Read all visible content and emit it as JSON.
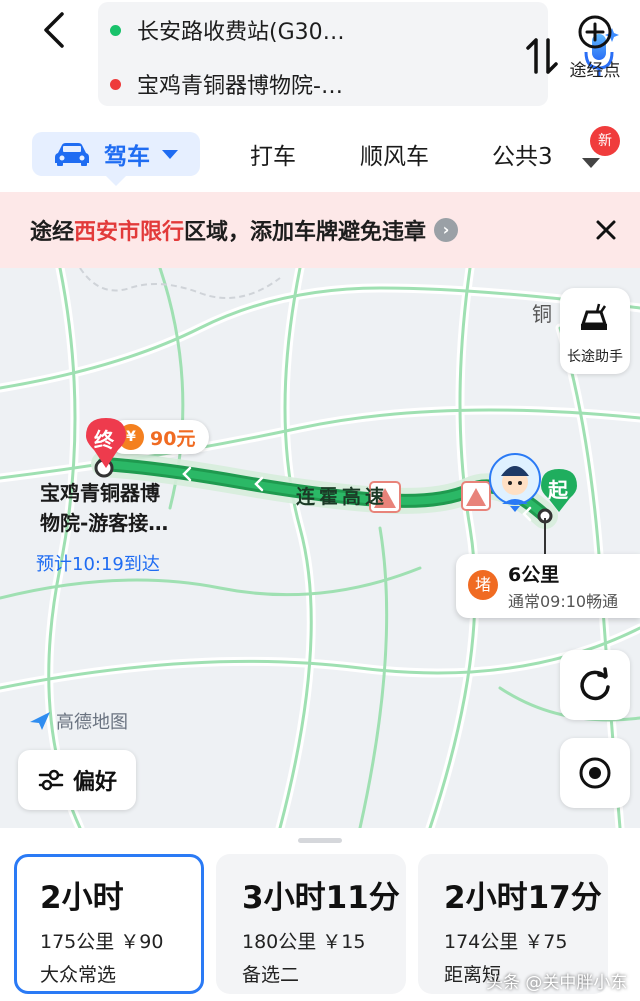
{
  "header": {
    "origin": "长安路收费站(G30…",
    "destination": "宝鸡青铜器博物院-…",
    "via_label": "途经点"
  },
  "tabs": [
    {
      "label": "驾车",
      "active": true
    },
    {
      "label": "打车"
    },
    {
      "label": "顺风车"
    },
    {
      "label": "公共3"
    }
  ],
  "more_badge": "新",
  "banner": {
    "prefix": "途经",
    "highlight": "西安市限行",
    "suffix": "区域，添加车牌避免违章"
  },
  "map": {
    "city_label": "铜",
    "dest_marker": "终",
    "price": "90元",
    "dest_name_line1": "宝鸡青铜器博",
    "dest_name_line2": "物院-游客接…",
    "eta": "预计10:19到达",
    "road_name": "连霍高速",
    "start_marker": "起",
    "jam": {
      "tag": "堵",
      "distance": "6公里",
      "detail": "通常09:10畅通"
    },
    "helper_label": "长途助手",
    "logo": "高德地图",
    "pref_label": "偏好"
  },
  "routes": [
    {
      "time": "2小时",
      "meta": "175公里 ￥90",
      "note": "大众常选",
      "selected": true
    },
    {
      "time": "3小时11分",
      "meta": "180公里 ￥15",
      "note": "备选二"
    },
    {
      "time": "2小时17分",
      "meta": "174公里 ￥75",
      "note": "距离短"
    }
  ],
  "watermark": "头条 @关中胖小东",
  "colors": {
    "accent": "#1f6cf2",
    "route_green": "#1f9a4f",
    "alert_red": "#e23a3a"
  }
}
